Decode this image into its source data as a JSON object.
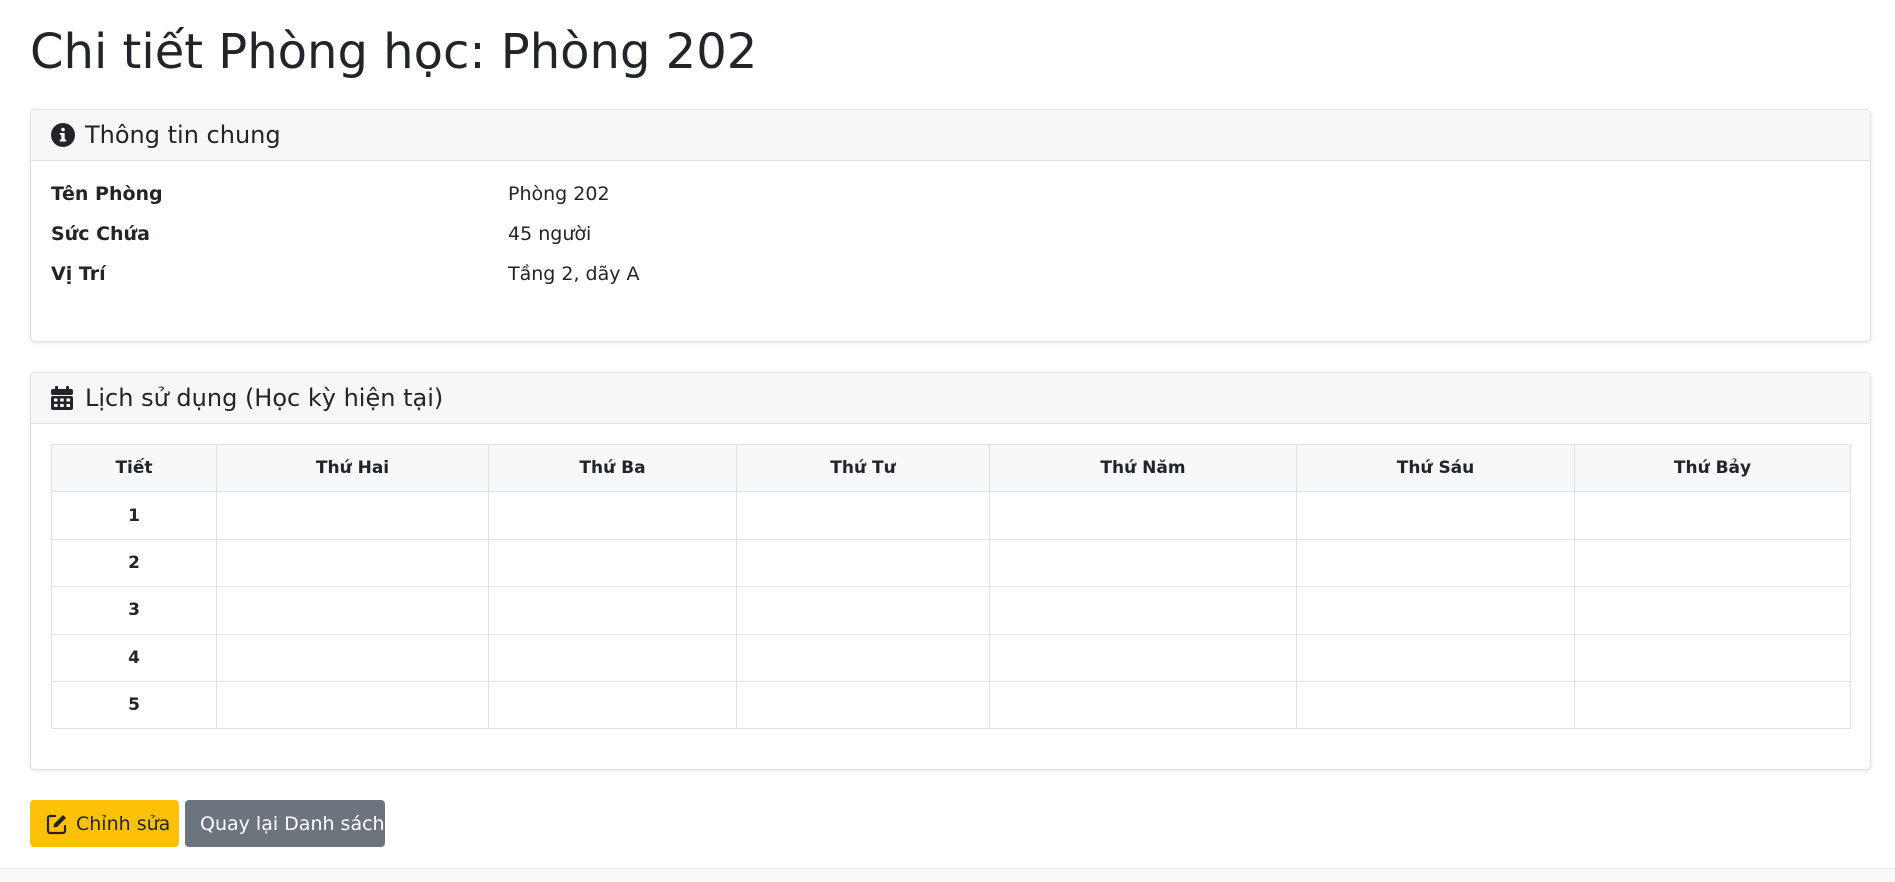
{
  "page": {
    "title": "Chi tiết Phòng học: Phòng 202"
  },
  "info_card": {
    "header": "Thông tin chung",
    "header_icon": "info-circle-icon",
    "rows": [
      {
        "label": "Tên Phòng",
        "value": "Phòng 202"
      },
      {
        "label": "Sức Chứa",
        "value": "45 người"
      },
      {
        "label": "Vị Trí",
        "value": "Tầng 2, dãy A"
      }
    ]
  },
  "schedule_card": {
    "header": "Lịch sử dụng (Học kỳ hiện tại)",
    "header_icon": "calendar-icon",
    "columns": [
      "Tiết",
      "Thứ Hai",
      "Thứ Ba",
      "Thứ Tư",
      "Thứ Năm",
      "Thứ Sáu",
      "Thứ Bảy"
    ],
    "periods": [
      "1",
      "2",
      "3",
      "4",
      "5"
    ]
  },
  "actions": {
    "edit_label": "Chỉnh sửa",
    "edit_icon": "edit-icon",
    "back_label": "Quay lại Danh sách"
  },
  "colors": {
    "edit_button": "#ffc107",
    "back_button": "#6c757d",
    "card_header_bg": "#f7f7f7",
    "border": "#dee2e6"
  }
}
